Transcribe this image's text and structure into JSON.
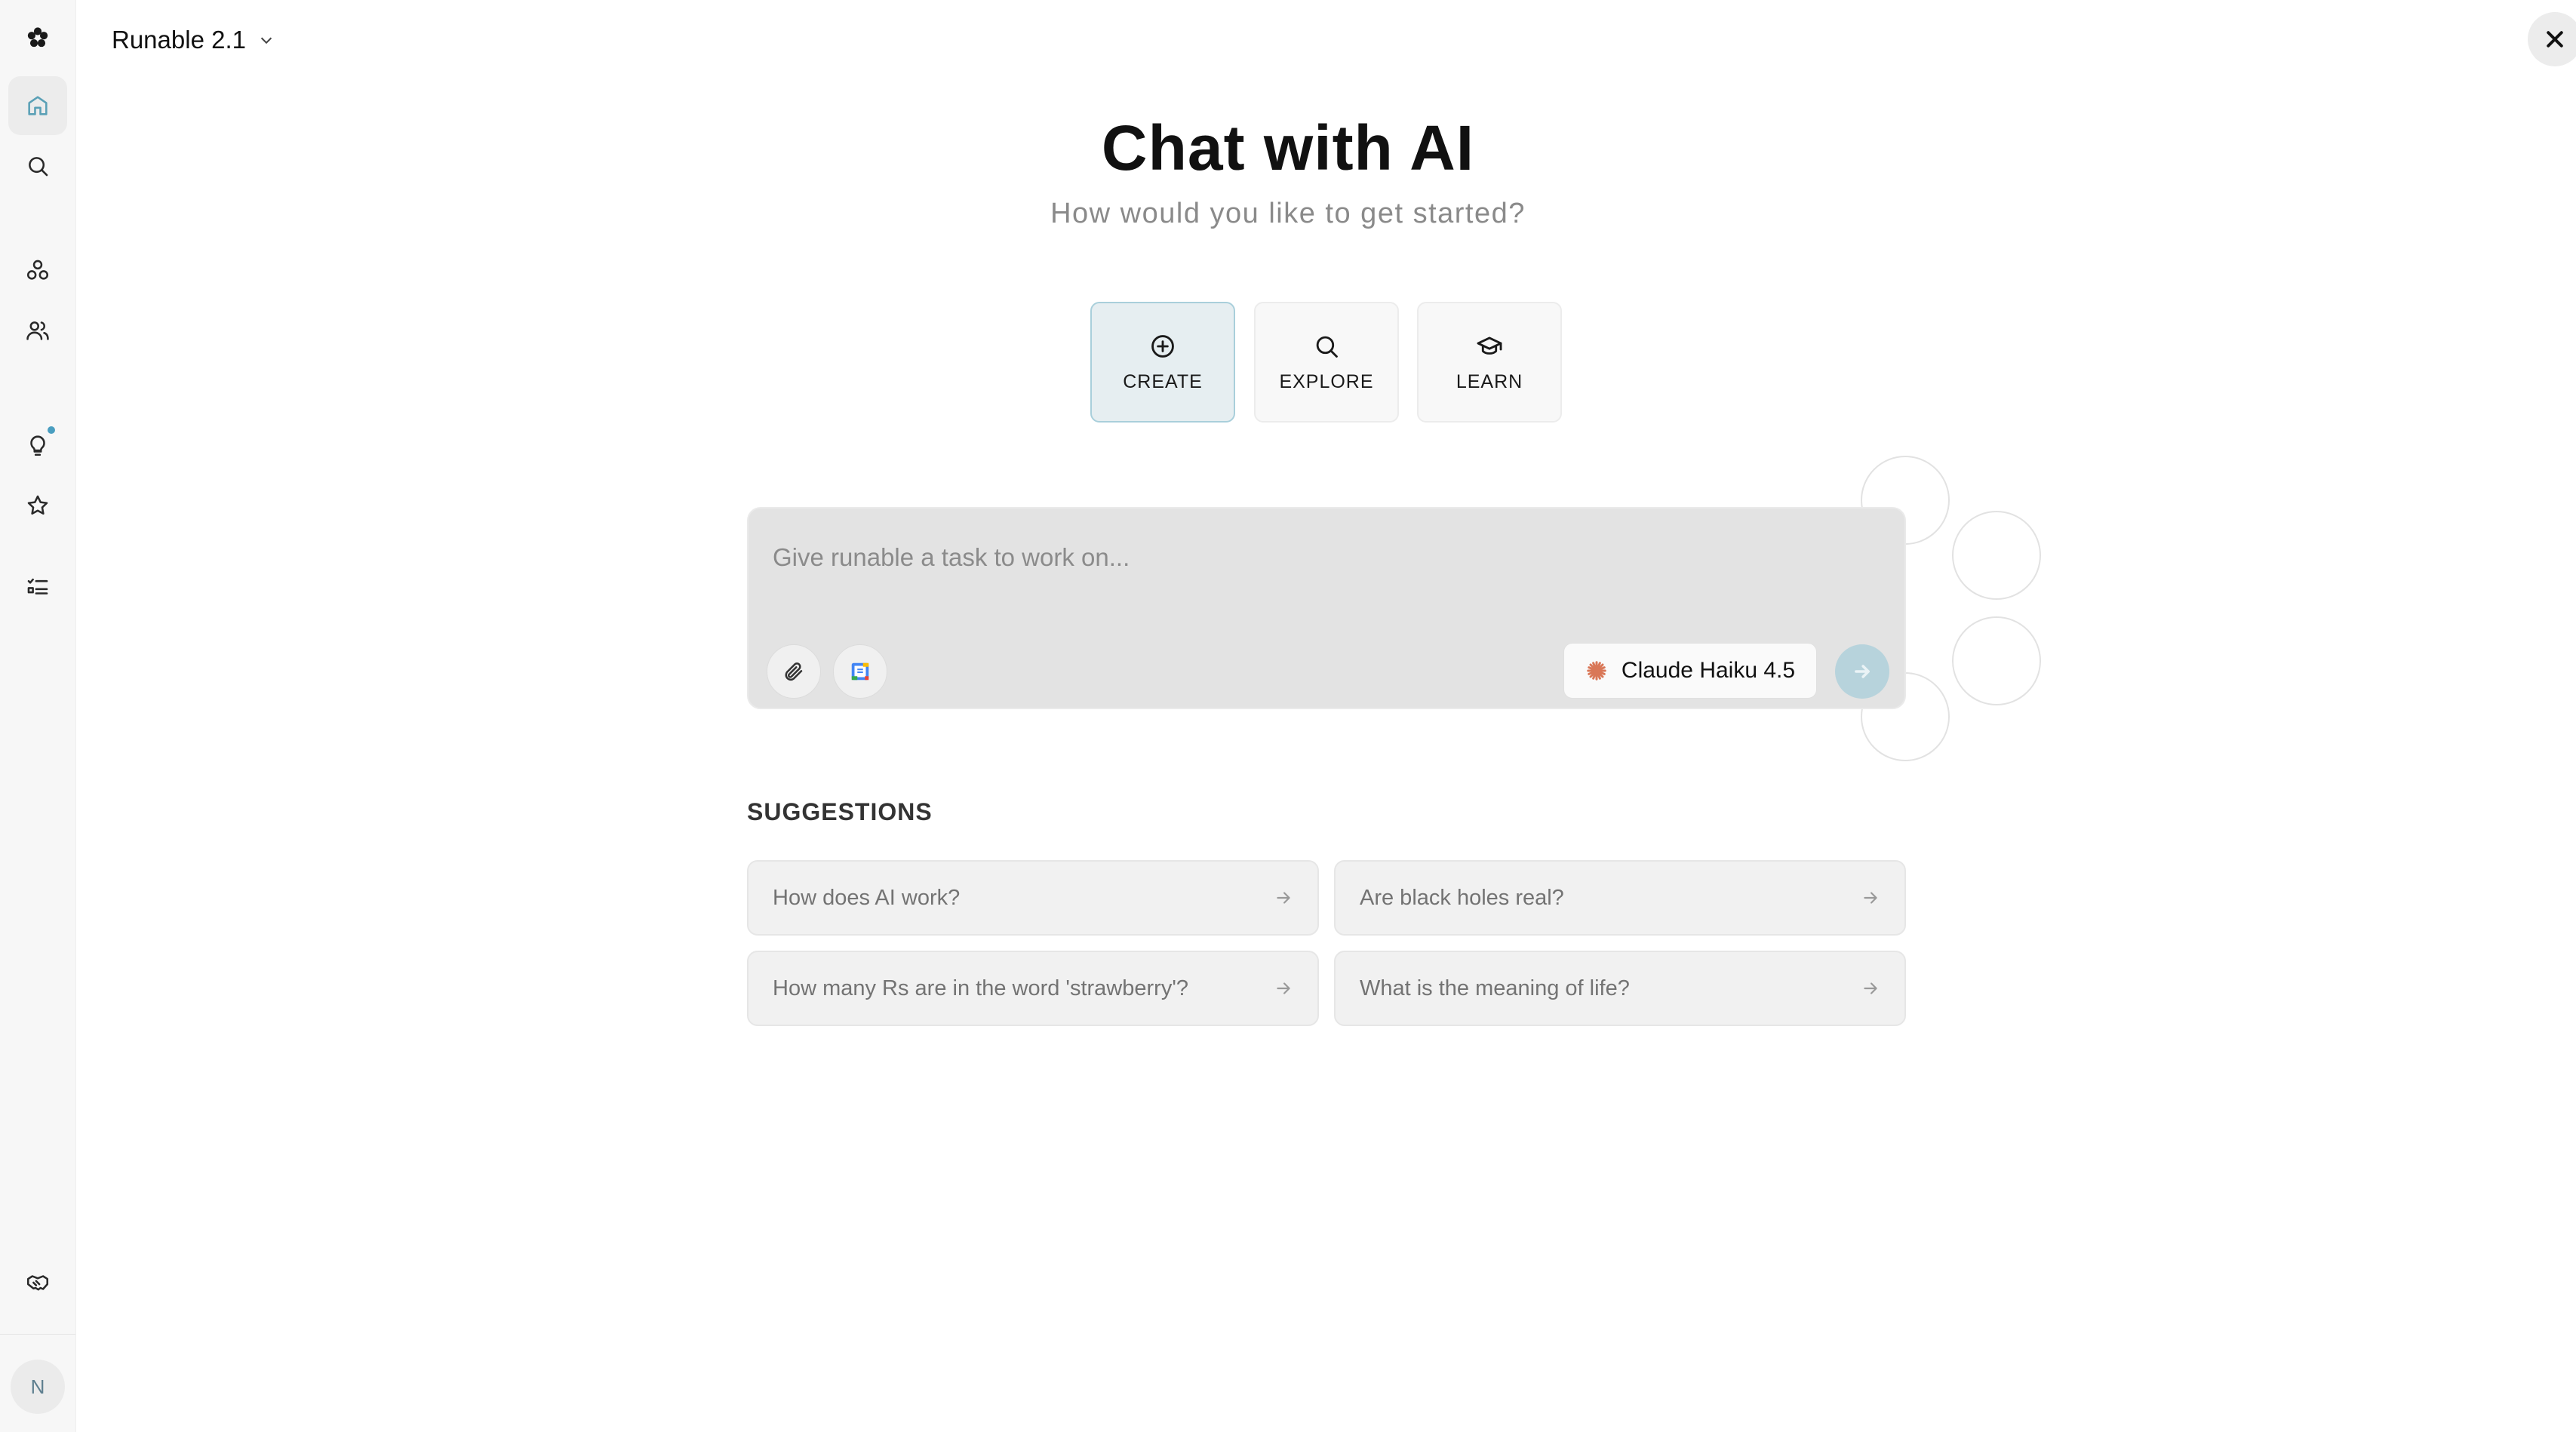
{
  "header": {
    "app_name": "Runable 2.1"
  },
  "sidebar": {
    "items": [
      {
        "icon": "logo-icon"
      },
      {
        "icon": "home-icon",
        "active": true
      },
      {
        "icon": "search-icon"
      },
      {
        "icon": "shapes-icon"
      },
      {
        "icon": "users-icon"
      },
      {
        "icon": "lightbulb-icon",
        "has_notification": true
      },
      {
        "icon": "star-icon"
      },
      {
        "icon": "tasks-icon"
      },
      {
        "icon": "handshake-icon"
      }
    ],
    "avatar_initial": "N"
  },
  "main": {
    "title": "Chat with AI",
    "subtitle": "How would you like to get started?",
    "modes": [
      {
        "label": "CREATE",
        "icon": "plus-circle-icon",
        "active": true
      },
      {
        "label": "EXPLORE",
        "icon": "search-icon"
      },
      {
        "label": "LEARN",
        "icon": "graduation-cap-icon"
      }
    ],
    "prompt": {
      "placeholder": "Give runable a task to work on...",
      "value": "",
      "model": "Claude Haiku 4.5"
    },
    "suggestions_title": "SUGGESTIONS",
    "suggestions": [
      "How does AI work?",
      "Are black holes real?",
      "How many Rs are in the word 'strawberry'?",
      "What is the meaning of life?"
    ]
  },
  "colors": {
    "accent": "#5aa0b6",
    "send_button": "#b7d3dc",
    "active_mode_bg": "#e6eef1",
    "claude_brand": "#d97757"
  }
}
